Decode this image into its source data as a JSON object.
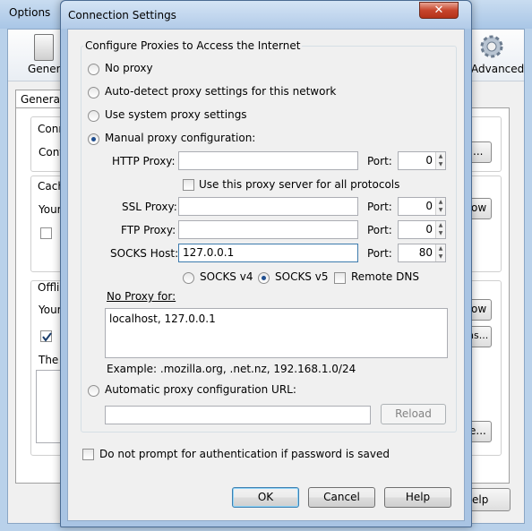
{
  "background_window": {
    "title": "Options",
    "panes": [
      {
        "label": "General"
      },
      {
        "label": "Advanced"
      }
    ],
    "tab_label": "General",
    "group1": {
      "heading": "Conn",
      "text": "Conf",
      "button": "..."
    },
    "group2": {
      "heading": "Cach",
      "text": "Your",
      "button": "ow"
    },
    "group3": {
      "heading": "Offlin",
      "text": "Your",
      "text2": "The",
      "button1": "ow",
      "button2": "ns..."
    },
    "partial_btn": "e...",
    "help_btn": "elp"
  },
  "dialog": {
    "title": "Connection Settings",
    "close_glyph": "✕",
    "group_label": "Configure Proxies to Access the Internet",
    "proxy_options": {
      "no_proxy": "No proxy",
      "auto_detect": "Auto-detect proxy settings for this network",
      "system": "Use system proxy settings",
      "manual": "Manual proxy configuration:",
      "auto_url": "Automatic proxy configuration URL:"
    },
    "selected_option": "manual",
    "http": {
      "label": "HTTP Proxy:",
      "value": "",
      "port_label": "Port:",
      "port": "0"
    },
    "use_for_all": {
      "label": "Use this proxy server for all protocols",
      "checked": false
    },
    "ssl": {
      "label": "SSL Proxy:",
      "value": "",
      "port_label": "Port:",
      "port": "0"
    },
    "ftp": {
      "label": "FTP Proxy:",
      "value": "",
      "port_label": "Port:",
      "port": "0"
    },
    "socks": {
      "label": "SOCKS Host:",
      "value": "127.0.0.1",
      "port_label": "Port:",
      "port": "80"
    },
    "socks_version": {
      "v4": "SOCKS v4",
      "v5": "SOCKS v5",
      "selected": "v5"
    },
    "remote_dns": {
      "label": "Remote DNS",
      "checked": false
    },
    "no_proxy_for": {
      "label": "No Proxy for:",
      "value": "localhost, 127.0.0.1"
    },
    "example": "Example: .mozilla.org, .net.nz, 192.168.1.0/24",
    "auto_url_value": "",
    "reload": "Reload",
    "no_prompt": {
      "label": "Do not prompt for authentication if password is saved",
      "checked": false
    },
    "buttons": {
      "ok": "OK",
      "cancel": "Cancel",
      "help": "Help"
    }
  }
}
